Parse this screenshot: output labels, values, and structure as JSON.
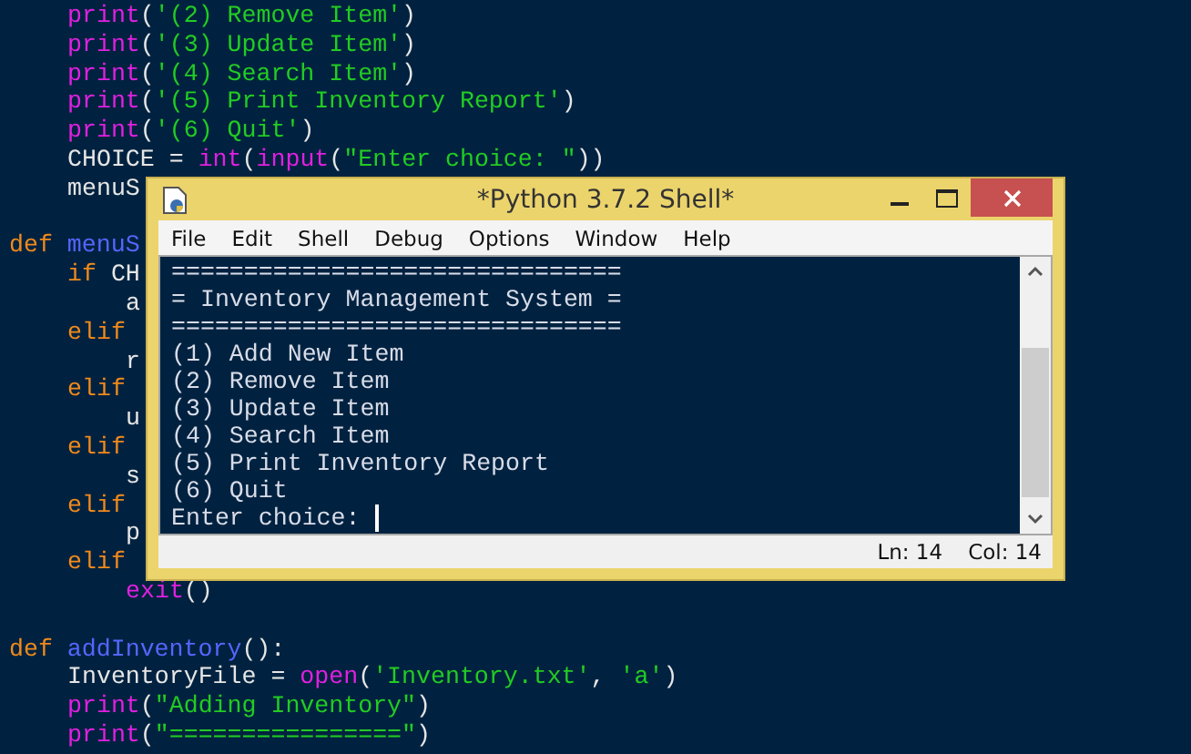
{
  "editor": {
    "lines": [
      {
        "kind": "continuation",
        "children": [
          {
            "kind": "code",
            "tokens": [
              {
                "t": "print",
                "kind": "builtin"
              },
              {
                "t": "(",
                "kind": "plain"
              },
              {
                "t": "'(2) Remove Item'",
                "kind": "string"
              },
              {
                "t": ")",
                "kind": "plain"
              }
            ]
          },
          {
            "kind": "code",
            "tokens": [
              {
                "t": "print",
                "kind": "builtin"
              },
              {
                "t": "(",
                "kind": "plain"
              },
              {
                "t": "'(3) Update Item'",
                "kind": "string"
              },
              {
                "t": ")",
                "kind": "plain"
              }
            ]
          },
          {
            "kind": "code",
            "tokens": [
              {
                "t": "print",
                "kind": "builtin"
              },
              {
                "t": "(",
                "kind": "plain"
              },
              {
                "t": "'(4) Search Item'",
                "kind": "string"
              },
              {
                "t": ")",
                "kind": "plain"
              }
            ]
          },
          {
            "kind": "code",
            "tokens": [
              {
                "t": "print",
                "kind": "builtin"
              },
              {
                "t": "(",
                "kind": "plain"
              },
              {
                "t": "'(5) Print Inventory Report'",
                "kind": "string"
              },
              {
                "t": ")",
                "kind": "plain"
              }
            ]
          },
          {
            "kind": "code",
            "tokens": [
              {
                "t": "print",
                "kind": "builtin"
              },
              {
                "t": "(",
                "kind": "plain"
              },
              {
                "t": "'(6) Quit'",
                "kind": "string"
              },
              {
                "t": ")",
                "kind": "plain"
              }
            ]
          },
          {
            "kind": "code",
            "tokens": [
              {
                "t": "CHOICE = ",
                "kind": "plain"
              },
              {
                "t": "int",
                "kind": "builtin"
              },
              {
                "t": "(",
                "kind": "plain"
              },
              {
                "t": "input",
                "kind": "builtin"
              },
              {
                "t": "(",
                "kind": "plain"
              },
              {
                "t": "\"Enter choice: \"",
                "kind": "string"
              },
              {
                "t": "))",
                "kind": "plain"
              }
            ]
          },
          {
            "kind": "code",
            "tokens": [
              {
                "t": "menuS",
                "kind": "plain"
              }
            ]
          }
        ]
      },
      {
        "kind": "blank"
      },
      {
        "kind": "code",
        "tokens": [
          {
            "t": "def ",
            "kind": "keyword"
          },
          {
            "t": "menuS",
            "kind": "defname"
          }
        ],
        "children": [
          {
            "kind": "code",
            "tokens": [
              {
                "t": "if ",
                "kind": "keyword"
              },
              {
                "t": "CH",
                "kind": "plain"
              }
            ],
            "children": [
              {
                "kind": "code",
                "tokens": [
                  {
                    "t": "a",
                    "kind": "plain"
                  }
                ]
              }
            ]
          },
          {
            "kind": "code",
            "tokens": [
              {
                "t": "elif",
                "kind": "keyword"
              }
            ],
            "children": [
              {
                "kind": "code",
                "tokens": [
                  {
                    "t": "r",
                    "kind": "plain"
                  }
                ]
              }
            ]
          },
          {
            "kind": "code",
            "tokens": [
              {
                "t": "elif",
                "kind": "keyword"
              }
            ],
            "children": [
              {
                "kind": "code",
                "tokens": [
                  {
                    "t": "u",
                    "kind": "plain"
                  }
                ]
              }
            ]
          },
          {
            "kind": "code",
            "tokens": [
              {
                "t": "elif",
                "kind": "keyword"
              }
            ],
            "children": [
              {
                "kind": "code",
                "tokens": [
                  {
                    "t": "s",
                    "kind": "plain"
                  }
                ]
              }
            ]
          },
          {
            "kind": "code",
            "tokens": [
              {
                "t": "elif",
                "kind": "keyword"
              }
            ],
            "children": [
              {
                "kind": "code",
                "tokens": [
                  {
                    "t": "p",
                    "kind": "plain"
                  }
                ]
              }
            ]
          },
          {
            "kind": "code",
            "tokens": [
              {
                "t": "elif",
                "kind": "keyword"
              }
            ],
            "children": [
              {
                "kind": "code",
                "tokens": [
                  {
                    "t": "exit",
                    "kind": "builtin"
                  },
                  {
                    "t": "()",
                    "kind": "plain"
                  }
                ]
              }
            ]
          }
        ]
      },
      {
        "kind": "blank"
      },
      {
        "kind": "code",
        "tokens": [
          {
            "t": "def ",
            "kind": "keyword"
          },
          {
            "t": "addInventory",
            "kind": "defname"
          },
          {
            "t": "():",
            "kind": "plain"
          }
        ],
        "children": [
          {
            "kind": "code",
            "tokens": [
              {
                "t": "InventoryFile = ",
                "kind": "plain"
              },
              {
                "t": "open",
                "kind": "builtin"
              },
              {
                "t": "(",
                "kind": "plain"
              },
              {
                "t": "'Inventory.txt'",
                "kind": "string"
              },
              {
                "t": ", ",
                "kind": "plain"
              },
              {
                "t": "'a'",
                "kind": "string"
              },
              {
                "t": ")",
                "kind": "plain"
              }
            ]
          },
          {
            "kind": "code",
            "tokens": [
              {
                "t": "print",
                "kind": "builtin"
              },
              {
                "t": "(",
                "kind": "plain"
              },
              {
                "t": "\"Adding Inventory\"",
                "kind": "string"
              },
              {
                "t": ")",
                "kind": "plain"
              }
            ]
          },
          {
            "kind": "code",
            "tokens": [
              {
                "t": "print",
                "kind": "builtin"
              },
              {
                "t": "(",
                "kind": "plain"
              },
              {
                "t": "\"================\"",
                "kind": "string"
              },
              {
                "t": ")",
                "kind": "plain"
              }
            ]
          }
        ]
      }
    ]
  },
  "shell_window": {
    "title": "*Python 3.7.2 Shell*",
    "menu": [
      "File",
      "Edit",
      "Shell",
      "Debug",
      "Options",
      "Window",
      "Help"
    ],
    "output": [
      "===============================",
      "= Inventory Management System =",
      "===============================",
      "(1) Add New Item",
      "(2) Remove Item",
      "(3) Update Item",
      "(4) Search Item",
      "(5) Print Inventory Report",
      "(6) Quit"
    ],
    "prompt": "Enter choice: ",
    "status": {
      "line": "Ln: 14",
      "column": "Col: 14"
    }
  }
}
